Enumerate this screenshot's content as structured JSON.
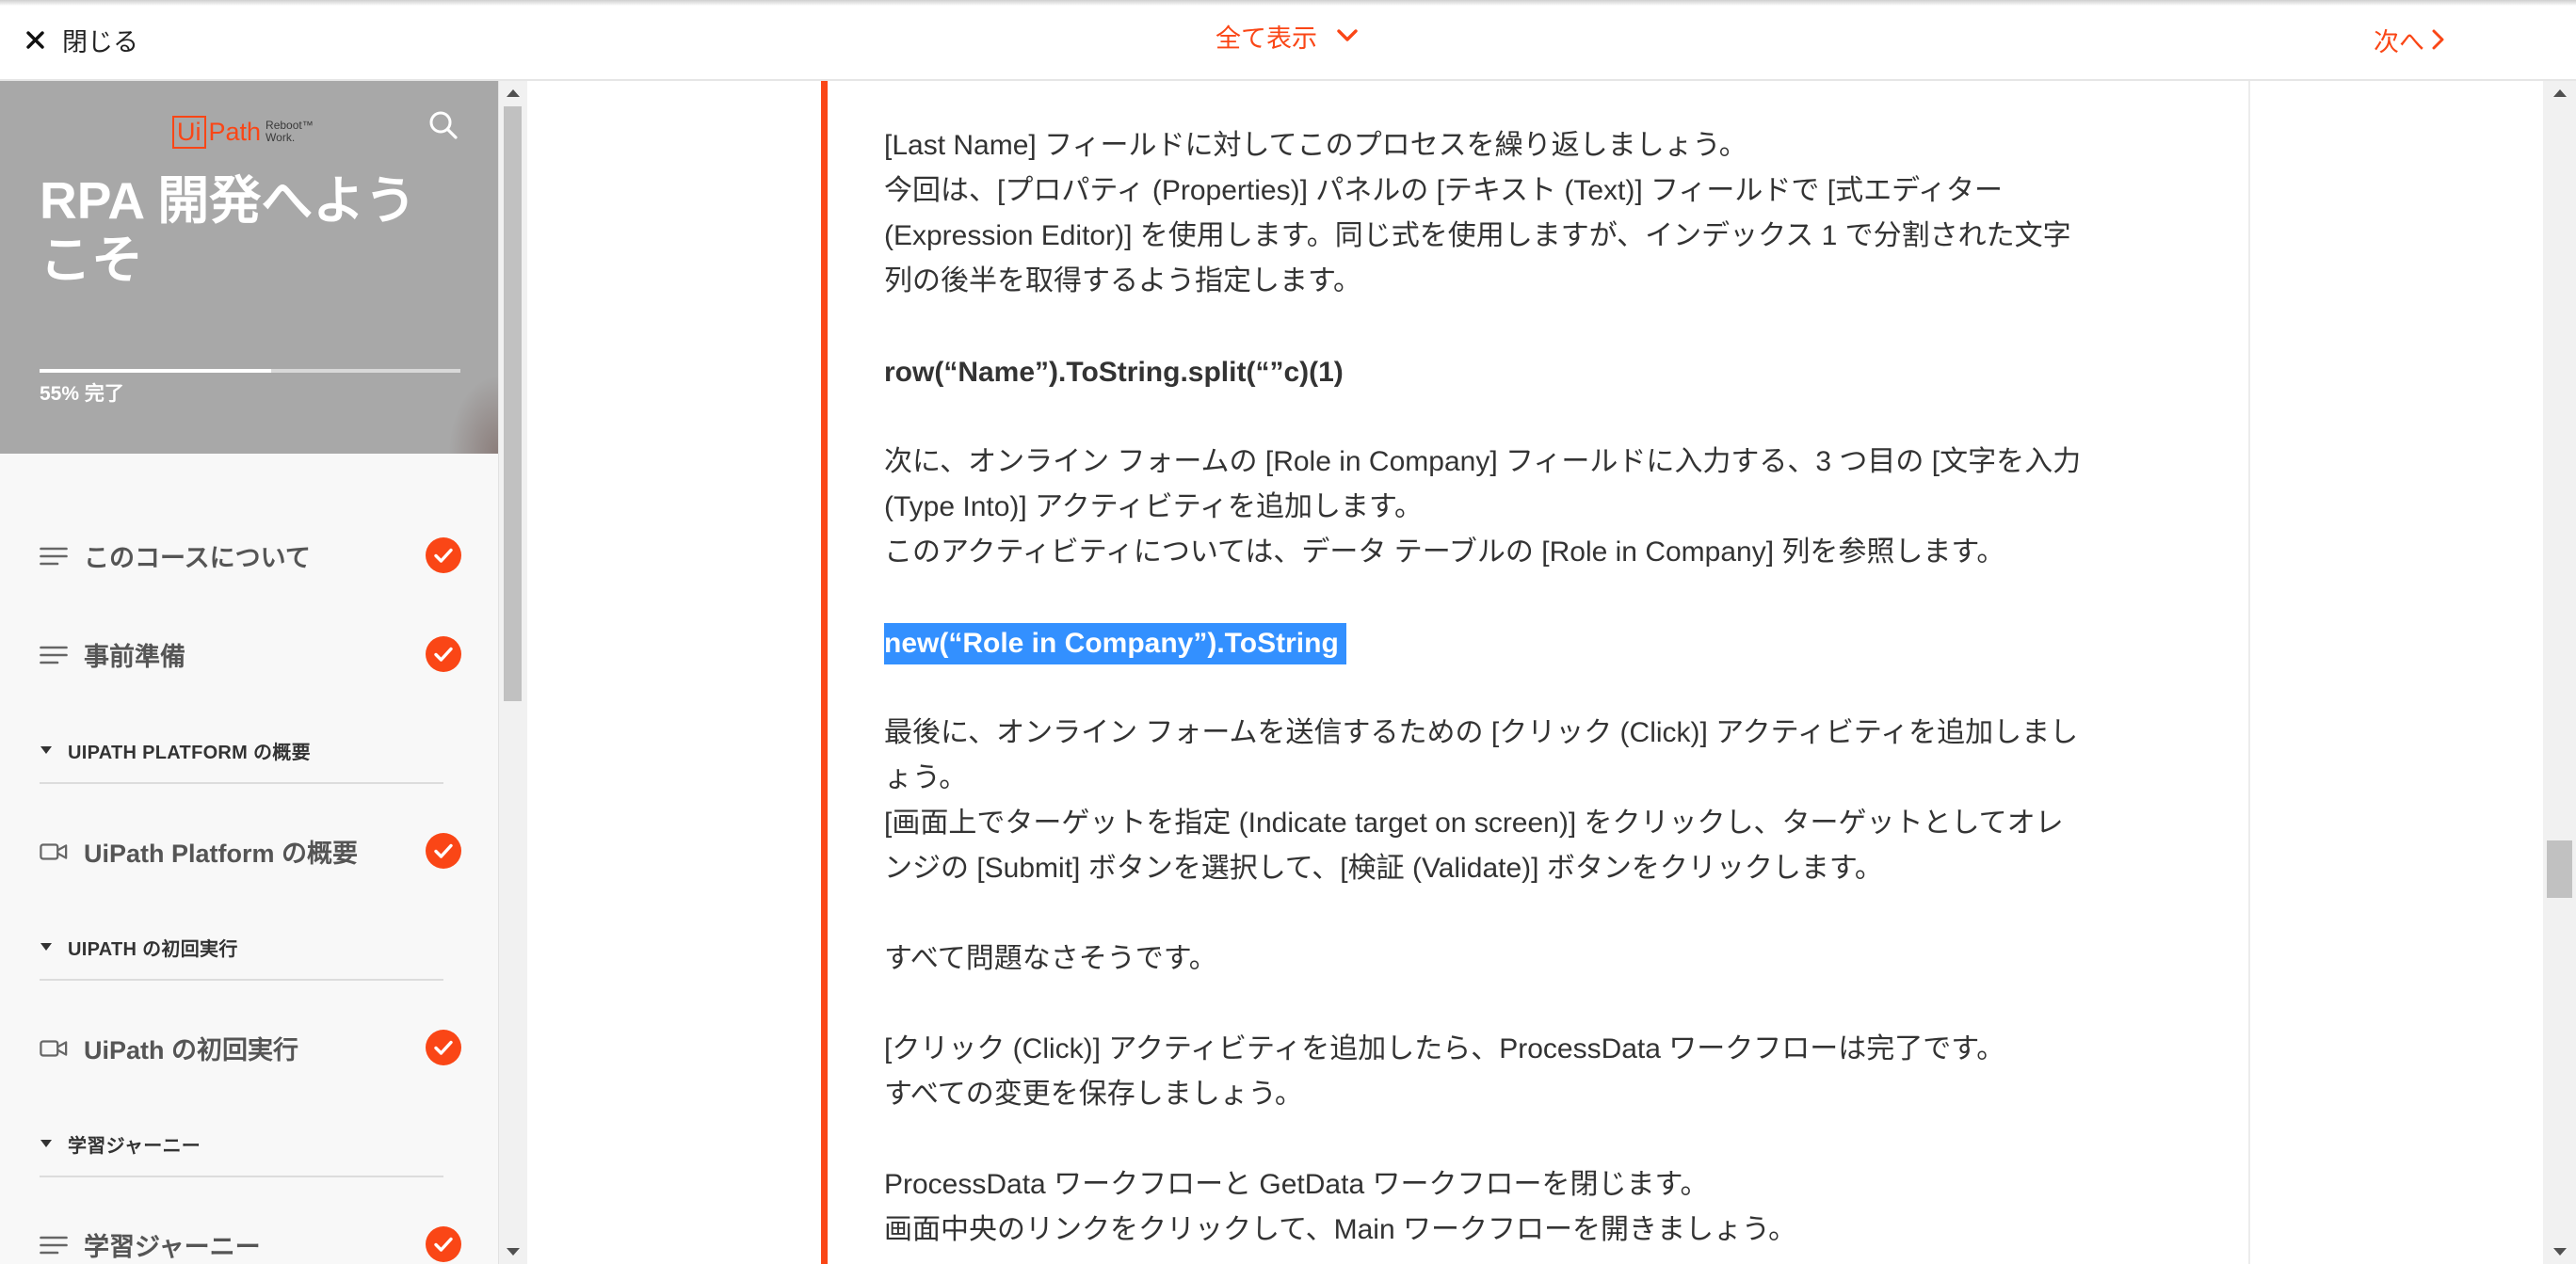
{
  "colors": {
    "accent": "#fa4616",
    "selection": "#3390ff",
    "sidebar_header": "#a8a8a8",
    "text": "#333333"
  },
  "topbar": {
    "close": {
      "icon": "close-icon",
      "label": "閉じる"
    },
    "show_all": {
      "label": "全て表示",
      "icon": "chevron-down-icon"
    },
    "next": {
      "label": "次へ",
      "icon": "chevron-right-icon"
    }
  },
  "sidebar": {
    "logo": {
      "mark_ui": "Ui",
      "mark_path": "Path",
      "tagline_top": "Reboot™",
      "tagline_bottom": "Work."
    },
    "search_icon": "search-icon",
    "course_title": "RPA 開発へようこそ",
    "progress": {
      "complete_fraction": 0.55,
      "label": "55% 完了"
    },
    "nav": {
      "lessons": [
        {
          "label": "このコースについて",
          "icon": "list-lines-icon",
          "completed": true
        },
        {
          "label": "事前準備",
          "icon": "list-lines-icon",
          "completed": true
        }
      ],
      "sections": [
        {
          "label": "UIPATH PLATFORM の概要",
          "expanded": true,
          "lessons": [
            {
              "label": "UiPath Platform の概要",
              "icon": "video-icon",
              "completed": true
            }
          ]
        },
        {
          "label": "UIPATH の初回実行",
          "expanded": true,
          "lessons": [
            {
              "label": "UiPath の初回実行",
              "icon": "video-icon",
              "completed": true
            }
          ]
        },
        {
          "label": "学習ジャーニー",
          "expanded": true,
          "lessons": [
            {
              "label": "学習ジャーニー",
              "icon": "list-lines-icon",
              "completed": true
            }
          ]
        }
      ]
    }
  },
  "content": {
    "paragraphs": [
      {
        "lines": [
          "[Last Name] フィールドに対してこのプロセスを繰り返しましょう。",
          "今回は、[プロパティ (Properties)] パネルの [テキスト (Text)] フィールドで [式エディター",
          "(Expression Editor)] を使用します。同じ式を使用しますが、インデックス 1 で分割された文字",
          "列の後半を取得するよう指定します。"
        ]
      },
      {
        "bold": true,
        "lines": [
          "row(“Name”).ToString.split(“”c)(1)"
        ]
      },
      {
        "lines": [
          "次に、オンライン フォームの [Role in Company] フィールドに入力する、3 つ目の [文字を入力",
          "(Type Into)] アクティビティを追加します。",
          "このアクティビティについては、データ テーブルの [Role in Company] 列を参照します。"
        ]
      },
      {
        "bold": true,
        "selected": true,
        "lines": [
          "new(“Role in Company”).ToString"
        ]
      },
      {
        "lines": [
          "最後に、オンライン フォームを送信するための [クリック (Click)] アクティビティを追加しまし",
          "ょう。",
          "[画面上でターゲットを指定 (Indicate target on screen)] をクリックし、ターゲットとしてオレ",
          "ンジの [Submit] ボタンを選択して、[検証 (Validate)] ボタンをクリックします。"
        ]
      },
      {
        "lines": [
          "すべて問題なさそうです。"
        ]
      },
      {
        "lines": [
          "[クリック (Click)] アクティビティを追加したら、ProcessData ワークフローは完了です。",
          "すべての変更を保存しましょう。"
        ]
      },
      {
        "lines": [
          "ProcessData ワークフローと GetData ワークフローを閉じます。",
          "画面中央のリンクをクリックして、Main ワークフローを開きましょう。"
        ]
      }
    ]
  }
}
